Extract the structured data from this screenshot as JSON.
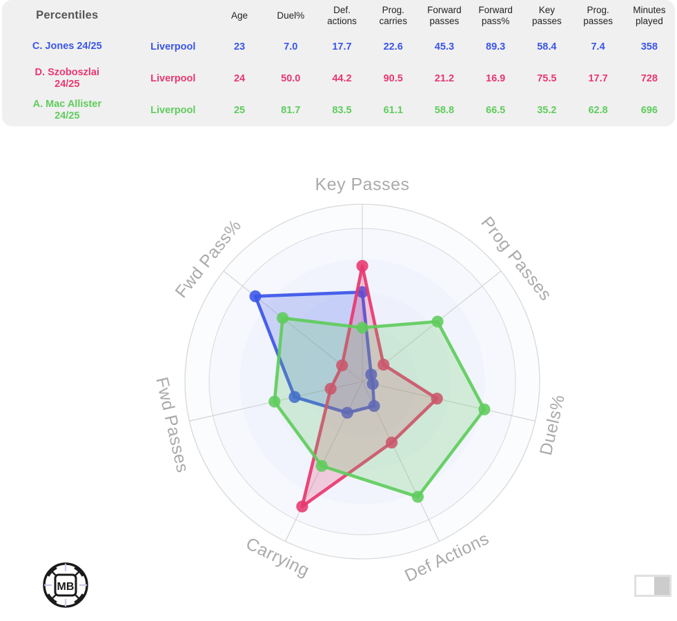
{
  "table": {
    "title": "Percentiles",
    "columns": [
      "Age",
      "Duel%",
      "Def. actions",
      "Prog. carries",
      "Forward passes",
      "Forward pass%",
      "Key passes",
      "Prog. passes",
      "Minutes played"
    ],
    "columns_split": [
      {
        "l1": "Age",
        "l2": ""
      },
      {
        "l1": "Duel%",
        "l2": ""
      },
      {
        "l1": "Def.",
        "l2": "actions"
      },
      {
        "l1": "Prog.",
        "l2": "carries"
      },
      {
        "l1": "Forward",
        "l2": "passes"
      },
      {
        "l1": "Forward",
        "l2": "pass%"
      },
      {
        "l1": "Key",
        "l2": "passes"
      },
      {
        "l1": "Prog.",
        "l2": "passes"
      },
      {
        "l1": "Minutes",
        "l2": "played"
      }
    ],
    "rows": [
      {
        "name_l1": "C. Jones 24/25",
        "name_l2": "",
        "team": "Liverpool",
        "color": "#3b55e8",
        "values": [
          "23",
          "7.0",
          "17.7",
          "22.6",
          "45.3",
          "89.3",
          "58.4",
          "7.4",
          "358"
        ]
      },
      {
        "name_l1": "D. Szoboszlai",
        "name_l2": "24/25",
        "team": "Liverpool",
        "color": "#e8376f",
        "values": [
          "24",
          "50.0",
          "44.2",
          "90.5",
          "21.2",
          "16.9",
          "75.5",
          "17.7",
          "728"
        ]
      },
      {
        "name_l1": "A. Mac Allister",
        "name_l2": "24/25",
        "team": "Liverpool",
        "color": "#5fcc5c",
        "values": [
          "25",
          "81.7",
          "83.5",
          "61.1",
          "58.8",
          "66.5",
          "35.2",
          "62.8",
          "696"
        ]
      }
    ]
  },
  "chart_data": {
    "type": "radar",
    "title": "",
    "axes": [
      "Key Passes",
      "Prog Passes",
      "Duels%",
      "Def Actions",
      "Carrying",
      "Fwd Passes",
      "Fwd Pass%"
    ],
    "range": [
      0,
      100
    ],
    "grid": true,
    "legend_position": "table-above",
    "series": [
      {
        "name": "C. Jones 24/25",
        "color": "#3b55e8",
        "values": [
          58.4,
          7.4,
          7.0,
          17.7,
          22.6,
          45.3,
          89.3
        ]
      },
      {
        "name": "D. Szoboszlai 24/25",
        "color": "#e8376f",
        "values": [
          75.5,
          17.7,
          50.0,
          44.2,
          90.5,
          21.2,
          16.9
        ]
      },
      {
        "name": "A. Mac Allister 24/25",
        "color": "#5fcc5c",
        "values": [
          35.2,
          62.8,
          81.7,
          83.5,
          61.1,
          58.8,
          66.5
        ]
      }
    ]
  },
  "branding": {
    "logo_text": "MB",
    "logo_name": "football-logo"
  }
}
